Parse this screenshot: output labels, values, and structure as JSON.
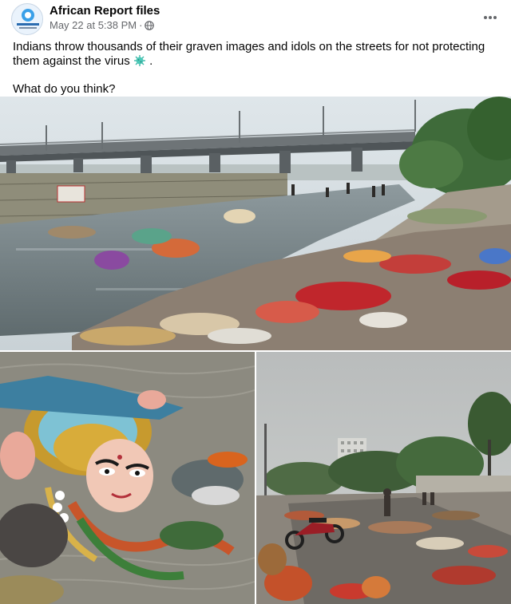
{
  "post": {
    "author": "African Report files",
    "avatar_text": "African Report files",
    "timestamp": "May 22 at 5:38 PM",
    "separator": "·",
    "privacy_icon": "globe-icon",
    "more_icon": "more-options-icon",
    "text_line1": "Indians throw thousands of their graven images and idols on the streets for not protecting them against the virus",
    "text_line1_end": ".",
    "virus_icon": "microbe-icon",
    "text_line2": "What do you think?"
  },
  "photos": [
    {
      "name": "riverbank-debris-photo"
    },
    {
      "name": "durga-idol-photo"
    },
    {
      "name": "street-debris-photo"
    }
  ],
  "colors": {
    "author": "#050505",
    "meta": "#65676b",
    "avatar_accent": "#1877f2"
  }
}
